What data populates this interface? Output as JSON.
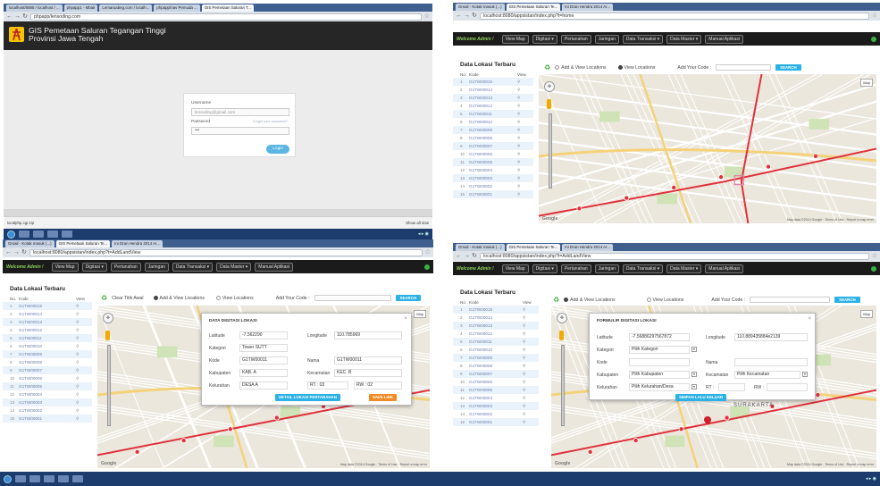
{
  "screens": [
    {
      "id": "login",
      "tabs": [
        "localhost/8080 / localhost / ...",
        "phpapp1 - Mbak",
        "Lemaruabeg.com / localh...",
        "phpapp/nav Pemuda ...",
        "GIS Pemetaan Saluran T..."
      ],
      "url": "phpapp/lensoding.com",
      "logo_icon": "electric-tower-icon",
      "app_title_line1": "GIS Pemetaan Saluran Tegangan Tinggi",
      "app_title_line2": "Provinsi Jawa Tengah",
      "form": {
        "username_label": "Username",
        "username_value": "lensoding@gmail.com",
        "password_label": "Password",
        "forgot_label": "Forgot your password?",
        "password_value": "•••",
        "login_button": "Login"
      },
      "status_left": "localphp.cgi.zip",
      "status_right": "Show all dow"
    },
    {
      "id": "home",
      "tabs": [
        "Gmail - Kotak masuk (...)",
        "GIS Pemetaan Saluran Te...",
        "Ini Dran Hendra 2014 Ar..."
      ],
      "url": "localhost:8080/appsistan/index.php?t=home"
    },
    {
      "id": "detail",
      "tabs": [
        "Gmail - Kotak masuk (...)",
        "GIS Pemetaan Saluran Te...",
        "Ini Dran Hendra 2014 Ar..."
      ],
      "url": "localhost:8080/appsistan/index.php?t=AddLandView",
      "clear_label": "Clear Titik Awal",
      "dialog": {
        "title": "DATA DIGITASI LOKASI",
        "latitude_label": "Latitude",
        "latitude_value": "-7.562290",
        "longitude_label": "Longitude",
        "longitude_value": "110.785969",
        "kategori_label": "Kategori",
        "kategori_value": "Tower SUTT",
        "kode_label": "Kode",
        "kode_value": "G1TW00011",
        "nama_label": "Nama",
        "nama_value": "G1TW00011",
        "kabupaten_label": "Kabupaten",
        "kabupaten_value": "KAB. A",
        "kecamatan_label": "Kecamatan",
        "kecamatan_value": "KEC. B",
        "kelurahan_label": "Kelurahan",
        "kelurahan_value": "DESA A",
        "rt_label": "RT : 03",
        "rw_label": "RW : 02",
        "detail_button": "DETAIL LOKASI PERTANAHAN",
        "save_button": "SAVE LINK"
      }
    },
    {
      "id": "form",
      "tabs": [
        "Gmail - Kotak masuk (...)",
        "GIS Pemetaan Saluran Te...",
        "Ini Dran Hendra 2014 Ar..."
      ],
      "url": "localhost:8080/appsistan/index.php?t=AddLandView",
      "dialog": {
        "title": "FORMULIR DIGITASI LOKASI",
        "latitude_label": "Latitude",
        "latitude_value": "-7.56886297567872",
        "longitude_label": "Longitude",
        "longitude_value": "110.889435884e2139",
        "kategori_label": "Kategori",
        "kategori_value": "Pilih Kategori",
        "kode_label": "Kode",
        "nama_label": "Nama",
        "kabupaten_label": "Kabupaten",
        "kabupaten_value": "Pilih Kabupaten",
        "kecamatan_label": "Kecamatan",
        "kecamatan_value": "Pilih Kecamatan",
        "kelurahan_label": "Kelurahan",
        "kelurahan_value": "Pilih Kelurahan/Desa",
        "rt_label": "RT :",
        "rw_label": "RW :",
        "save_button": "SIMPAN LALU KELUAR"
      },
      "map_city_label": "SURAKARTA"
    }
  ],
  "common": {
    "welcome": "Welcome Admin !",
    "nav": [
      "View Map",
      "Digitasi ▾",
      "Pertanahan",
      "Jaringan",
      "Data Transaksi ▾",
      "Data Master ▾",
      "Manual Aplikasi"
    ],
    "sidebar_title": "Data Lokasi Terbaru",
    "col_no": "No.",
    "col_kode": "Kode",
    "col_view": "View",
    "codes": [
      "G1TW00015",
      "G1TW00014",
      "G1TW00013",
      "G1TW00012",
      "G1TW00011",
      "G1TW00010",
      "G1TW00009",
      "G1TW00008",
      "G1TW00007",
      "G1TW00006",
      "G1TW00005",
      "G1TW00004",
      "G1TW00003",
      "G1TW00002",
      "G1TW00001"
    ],
    "radio_add": "Add & View Locations",
    "radio_view": "View Locations",
    "your_code": "Add Your Code :",
    "search_button": "SEARCH",
    "map_button": "Map",
    "attribution": "Map data ©2014 Google · Terms of Use · Report a map error",
    "google": "Google"
  },
  "colors": {
    "nav_bg": "#1b1b1b",
    "welcome": "#8fd35a",
    "accent_blue": "#2bb1e6",
    "save_orange": "#f08a24",
    "route_red": "#e0313b",
    "road_yellow": "#f4d27a",
    "map_bg": "#ebe7dd",
    "taskbar": "#1c3c6e"
  }
}
